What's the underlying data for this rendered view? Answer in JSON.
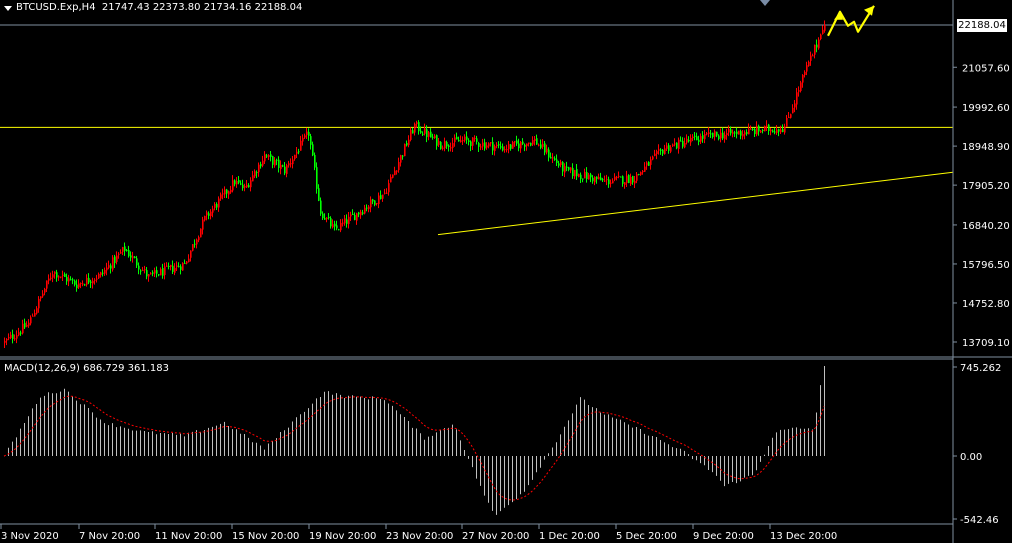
{
  "window": {
    "symbol_title": "BTCUSD.Exp,H4",
    "ohlc": "21747.43 22373.80 21734.16 22188.04",
    "current_price": "22188.04"
  },
  "macd": {
    "label": "MACD(12,26,9) 686.729 361.183"
  },
  "colors": {
    "background": "#000000",
    "bull_candle": "#ff0000",
    "bear_candle": "#00ff00",
    "axis_text": "#ffffff",
    "level_line": "#ffff00",
    "trend_line": "#ffff00",
    "projection_arrow": "#ffff00",
    "histogram": "#c0c0c0",
    "signal_line": "#ff0000",
    "grid_border": "#8090a0"
  },
  "chart_data": [
    {
      "type": "candlestick",
      "title": "BTCUSD.Exp,H4",
      "y_ticks": [
        "22188.04",
        "21057.60",
        "19992.60",
        "18948.90",
        "17905.20",
        "16840.20",
        "15796.50",
        "14752.80",
        "13709.10"
      ],
      "y_tick_values": [
        22188.04,
        21057.6,
        19992.6,
        18948.9,
        17905.2,
        16840.2,
        15796.5,
        14752.8,
        13709.1
      ],
      "ylim": [
        13500,
        22550
      ],
      "x_ticks": [
        "3 Nov 2020",
        "7 Nov 20:00",
        "11 Nov 20:00",
        "15 Nov 20:00",
        "19 Nov 20:00",
        "23 Nov 20:00",
        "27 Nov 20:00",
        "1 Dec 20:00",
        "5 Dec 20:00",
        "9 Dec 20:00",
        "13 Dec 20:00"
      ],
      "close_path": [
        {
          "date": "3 Nov 2020",
          "price": 13700
        },
        {
          "date": "4 Nov",
          "price": 14200
        },
        {
          "date": "5 Nov",
          "price": 15600
        },
        {
          "date": "7 Nov",
          "price": 15250
        },
        {
          "date": "8 Nov",
          "price": 15500
        },
        {
          "date": "11 Nov",
          "price": 15450
        },
        {
          "date": "13 Nov",
          "price": 16200
        },
        {
          "date": "15 Nov",
          "price": 15800
        },
        {
          "date": "17 Nov",
          "price": 17000
        },
        {
          "date": "18 Nov",
          "price": 18000
        },
        {
          "date": "19 Nov",
          "price": 17800
        },
        {
          "date": "20 Nov",
          "price": 18700
        },
        {
          "date": "22 Nov",
          "price": 18300
        },
        {
          "date": "24 Nov",
          "price": 19300
        },
        {
          "date": "25 Nov",
          "price": 17200
        },
        {
          "date": "26 Nov",
          "price": 16700
        },
        {
          "date": "27 Nov",
          "price": 17100
        },
        {
          "date": "28 Nov",
          "price": 17700
        },
        {
          "date": "30 Nov",
          "price": 19500
        },
        {
          "date": "1 Dec",
          "price": 19000
        },
        {
          "date": "2 Dec",
          "price": 19100
        },
        {
          "date": "4 Dec",
          "price": 18900
        },
        {
          "date": "6 Dec",
          "price": 19100
        },
        {
          "date": "8 Dec",
          "price": 18300
        },
        {
          "date": "9 Dec",
          "price": 18000
        },
        {
          "date": "11 Dec",
          "price": 18100
        },
        {
          "date": "12 Dec",
          "price": 18900
        },
        {
          "date": "14 Dec",
          "price": 19200
        },
        {
          "date": "16 Dec",
          "price": 19450
        },
        {
          "date": "17 Dec",
          "price": 20900
        },
        {
          "date": "17 Dec 20:00",
          "price": 22188.04
        }
      ],
      "resistance_level": 19450,
      "trend_line": [
        {
          "date": "25 Nov",
          "price": 16580
        },
        {
          "date": "end",
          "price": 18250
        }
      ],
      "projection": "upward zig-zag arrow beyond last candle",
      "grid": false
    },
    {
      "type": "macd",
      "title": "MACD(12,26,9) 686.729 361.183",
      "main": 686.729,
      "signal": 361.183,
      "y_ticks": [
        "745.262",
        "0.00",
        "-542.46"
      ],
      "y_tick_values": [
        745.262,
        0,
        -542.46
      ],
      "ylim": [
        -580,
        800
      ],
      "histogram_path": [
        {
          "date": "3 Nov 2020",
          "value": 0
        },
        {
          "date": "5 Nov",
          "value": 500
        },
        {
          "date": "6 Nov",
          "value": 560
        },
        {
          "date": "8 Nov",
          "value": 280
        },
        {
          "date": "10 Nov",
          "value": 200
        },
        {
          "date": "12 Nov",
          "value": 170
        },
        {
          "date": "14 Nov",
          "value": 280
        },
        {
          "date": "16 Nov",
          "value": 60
        },
        {
          "date": "18 Nov",
          "value": 540
        },
        {
          "date": "19 Nov",
          "value": 500
        },
        {
          "date": "21 Nov",
          "value": 480
        },
        {
          "date": "23 Nov",
          "value": 150
        },
        {
          "date": "24 Nov",
          "value": 270
        },
        {
          "date": "25 Nov",
          "value": -150
        },
        {
          "date": "26 Nov",
          "value": -520
        },
        {
          "date": "28 Nov",
          "value": -300
        },
        {
          "date": "29 Nov",
          "value": 100
        },
        {
          "date": "30 Nov",
          "value": 480
        },
        {
          "date": "2 Dec",
          "value": 350
        },
        {
          "date": "4 Dec",
          "value": 200
        },
        {
          "date": "6 Dec",
          "value": 30
        },
        {
          "date": "8 Dec",
          "value": -150
        },
        {
          "date": "9 Dec",
          "value": -260
        },
        {
          "date": "11 Dec",
          "value": -160
        },
        {
          "date": "12 Dec",
          "value": 200
        },
        {
          "date": "14 Dec",
          "value": 230
        },
        {
          "date": "16 Dec",
          "value": 230
        },
        {
          "date": "17 Dec",
          "value": 500
        },
        {
          "date": "17 Dec 20:00",
          "value": 745
        }
      ]
    }
  ]
}
